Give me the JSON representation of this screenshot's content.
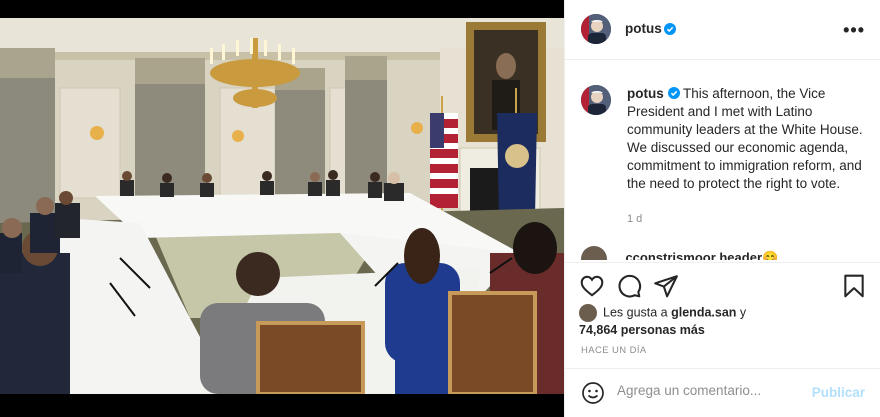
{
  "post": {
    "username": "potus",
    "caption_username": "potus",
    "caption_text": "This afternoon, the Vice President and I met with Latino community leaders at the White House. We discussed our economic agenda, commitment to immigration reform, and the need to protect the right to vote.",
    "caption_age": "1 d",
    "peek_comment": "cconstrismoor header😊",
    "likes_prefix": "Les gusta a",
    "likes_user": "glenda.san",
    "likes_suffix": "y",
    "likes_count": "74,864",
    "likes_others": "personas más",
    "posted_ago": "HACE UN DÍA"
  },
  "comment_box": {
    "placeholder": "Agrega un comentario...",
    "post_label": "Publicar"
  },
  "icons": {
    "more": "more-options-icon",
    "like": "heart-icon",
    "comment": "comment-icon",
    "share": "share-icon",
    "save": "bookmark-icon",
    "emoji": "emoji-icon",
    "verified": "verified-badge-icon"
  },
  "colors": {
    "verified": "#0095f6",
    "link_disabled": "#b2dffc",
    "muted": "#8e8e8e",
    "text": "#262626"
  }
}
